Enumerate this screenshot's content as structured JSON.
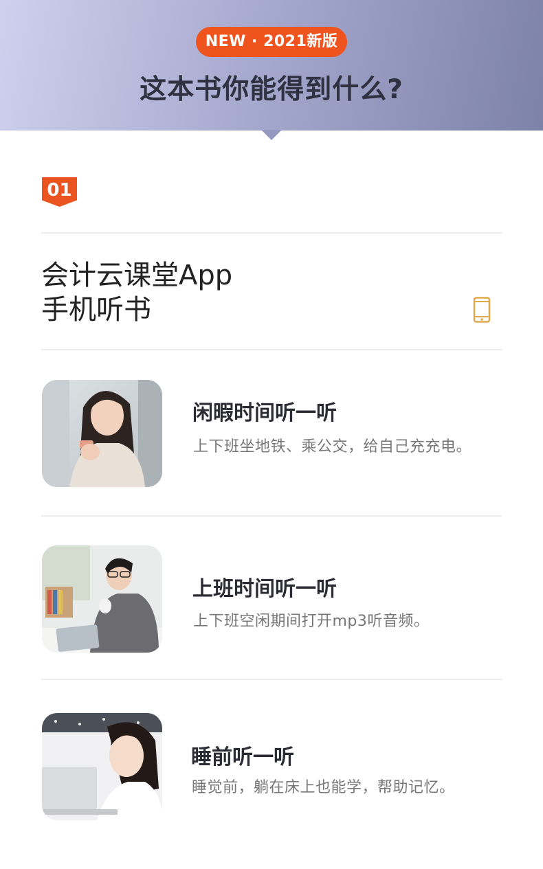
{
  "header": {
    "badge": "NEW · 2021新版",
    "title": "这本书你能得到什么?",
    "colors": {
      "gradient_start": "#cfd0ee",
      "gradient_end": "#7d82a8",
      "badge": "#f0541e"
    }
  },
  "section": {
    "number": "01",
    "title_line1": "会计云课堂App",
    "title_line2": "手机听书",
    "icon": "smartphone-icon",
    "accent_color": "#e95420"
  },
  "items": [
    {
      "title": "闲暇时间听一听",
      "desc": "上下班坐地铁、乘公交，给自己充充电。",
      "image": "woman-with-phone-photo"
    },
    {
      "title": "上班时间听一听",
      "desc": "上下班空闲期间打开mp3听音频。",
      "image": "man-with-tablet-photo"
    },
    {
      "title": "睡前听一听",
      "desc": "睡觉前，躺在床上也能学，帮助记忆。",
      "image": "woman-with-laptop-photo"
    }
  ]
}
